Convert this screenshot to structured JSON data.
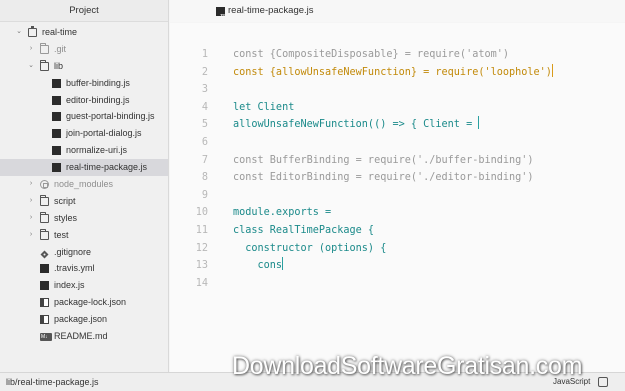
{
  "sidebar": {
    "title": "Project",
    "items": [
      {
        "label": "real-time",
        "icon": "repo-icon",
        "chevron": "⌄",
        "indent": 0
      },
      {
        "label": ".git",
        "icon": "folder-icon",
        "chevron": "›",
        "indent": 1,
        "ignored": true
      },
      {
        "label": "lib",
        "icon": "folder-icon",
        "chevron": "⌄",
        "indent": 1
      },
      {
        "label": "buffer-binding.js",
        "icon": "js-icon",
        "indent": 2
      },
      {
        "label": "editor-binding.js",
        "icon": "js-icon",
        "indent": 2
      },
      {
        "label": "guest-portal-binding.js",
        "icon": "js-icon",
        "indent": 2
      },
      {
        "label": "join-portal-dialog.js",
        "icon": "js-icon",
        "indent": 2
      },
      {
        "label": "normalize-uri.js",
        "icon": "js-icon",
        "indent": 2
      },
      {
        "label": "real-time-package.js",
        "icon": "js-icon",
        "indent": 2,
        "selected": true
      },
      {
        "label": "node_modules",
        "icon": "node-icon",
        "chevron": "›",
        "indent": 1,
        "ignored": true
      },
      {
        "label": "script",
        "icon": "folder-icon",
        "chevron": "›",
        "indent": 1
      },
      {
        "label": "styles",
        "icon": "folder-icon",
        "chevron": "›",
        "indent": 1
      },
      {
        "label": "test",
        "icon": "folder-icon",
        "chevron": "›",
        "indent": 1
      },
      {
        "label": ".gitignore",
        "icon": "git-icon",
        "indent": 1
      },
      {
        "label": ".travis.yml",
        "icon": "js-icon",
        "indent": 1
      },
      {
        "label": "index.js",
        "icon": "js-icon",
        "indent": 1
      },
      {
        "label": "package-lock.json",
        "icon": "package-icon",
        "indent": 1
      },
      {
        "label": "package.json",
        "icon": "package-icon",
        "indent": 1
      },
      {
        "label": "README.md",
        "icon": "markdown-icon",
        "indent": 1
      }
    ]
  },
  "tab": {
    "title": "real-time-package.js",
    "icon": "js-icon"
  },
  "editor": {
    "lines": [
      {
        "n": "1",
        "text": "const {CompositeDisposable} = require('atom')",
        "style": "gray"
      },
      {
        "n": "2",
        "text": "const {allowUnsafeNewFunction} = require('loophole')",
        "style": "gold",
        "cursor": "gold"
      },
      {
        "n": "3",
        "text": "",
        "style": "gray"
      },
      {
        "n": "4",
        "text": "let Client",
        "style": "teal"
      },
      {
        "n": "5",
        "text": "allowUnsafeNewFunction(() => { Client = ",
        "style": "teal",
        "cursor": "teal"
      },
      {
        "n": "6",
        "text": "",
        "style": "gray"
      },
      {
        "n": "7",
        "text": "const BufferBinding = require('./buffer-binding')",
        "style": "gray"
      },
      {
        "n": "8",
        "text": "const EditorBinding = require('./editor-binding')",
        "style": "gray"
      },
      {
        "n": "9",
        "text": "",
        "style": "gray"
      },
      {
        "n": "10",
        "text": "module.exports =",
        "style": "teal"
      },
      {
        "n": "11",
        "text": "class RealTimePackage {",
        "style": "teal"
      },
      {
        "n": "12",
        "text": "  constructor (options) {",
        "style": "teal"
      },
      {
        "n": "13",
        "text": "    cons",
        "style": "teal",
        "cursor": "teal"
      },
      {
        "n": "14",
        "text": "",
        "style": "gray"
      }
    ]
  },
  "statusbar": {
    "path": "lib/real-time-package.js",
    "grammar": "JavaScript"
  },
  "watermark": "DownloadSoftwareGratisan.com",
  "colors": {
    "gold": "#c28a0a",
    "teal": "#1b8a8a",
    "gray": "#9a9a9a",
    "selected_row": "#d8d8dc"
  }
}
